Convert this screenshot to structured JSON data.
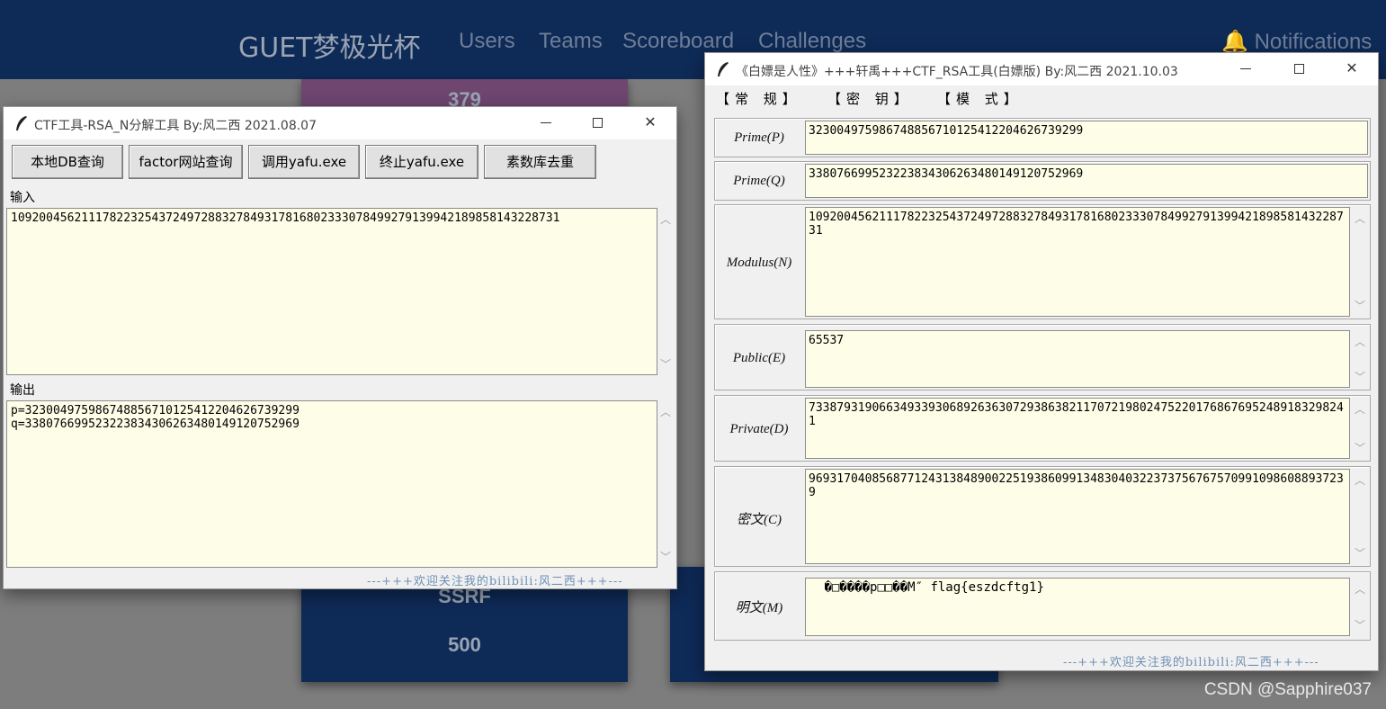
{
  "ctfd": {
    "brand": "GUET梦极光杯",
    "nav": [
      "Users",
      "Teams",
      "Scoreboard",
      "Challenges"
    ],
    "notifications": "Notifications",
    "cards": [
      {
        "value": "379"
      },
      {
        "name": "SSRF",
        "value": "500"
      }
    ]
  },
  "factor_window": {
    "title": "CTF工具-RSA_N分解工具   By:风二西 2021.08.07",
    "buttons": [
      "本地DB查询",
      "factor网站查询",
      "调用yafu.exe",
      "终止yafu.exe",
      "素数库去重"
    ],
    "input_label": "输入",
    "input_value": "109200456211178223254372497288327849317816802333078499279139942189858143228731",
    "output_label": "输出",
    "output_value": "p=323004975986748856710125412204626739299\nq=338076699523223834306263480149120752969",
    "footer": "---+++欢迎关注我的bilibili:风二西+++---"
  },
  "rsa_window": {
    "title": "《白嫖是人性》+++轩禹+++CTF_RSA工具(白嫖版)  By:风二西 2021.10.03",
    "menu": [
      "【常  规】",
      "【密  钥】",
      "【模  式】"
    ],
    "fields": [
      {
        "label": "Prime(P)",
        "value": "323004975986748856710125412204626739299"
      },
      {
        "label": "Prime(Q)",
        "value": "338076699523223834306263480149120752969"
      },
      {
        "label": "Modulus(N)",
        "value": "109200456211178223254372497288327849317816802333078499279139942189858143228731"
      },
      {
        "label": "Public(E)",
        "value": "65537"
      },
      {
        "label": "Private(D)",
        "value": "73387931906634933930689263630729386382117072198024752201768676952489183298241"
      },
      {
        "label": "密文(C)",
        "value": "96931704085687712431384890022519386099134830403223737567675709910986088937239"
      },
      {
        "label": "明文(M)",
        "value": " �□����p□□��M″ flag{eszdcftg1}"
      }
    ],
    "footer": "---+++欢迎关注我的bilibili:风二西+++---"
  },
  "watermark": "CSDN @Sapphire037",
  "colors": {
    "navbar": "#0e2a57",
    "textarea_bg": "#fefee8",
    "footer_text": "#6f8fb5"
  }
}
